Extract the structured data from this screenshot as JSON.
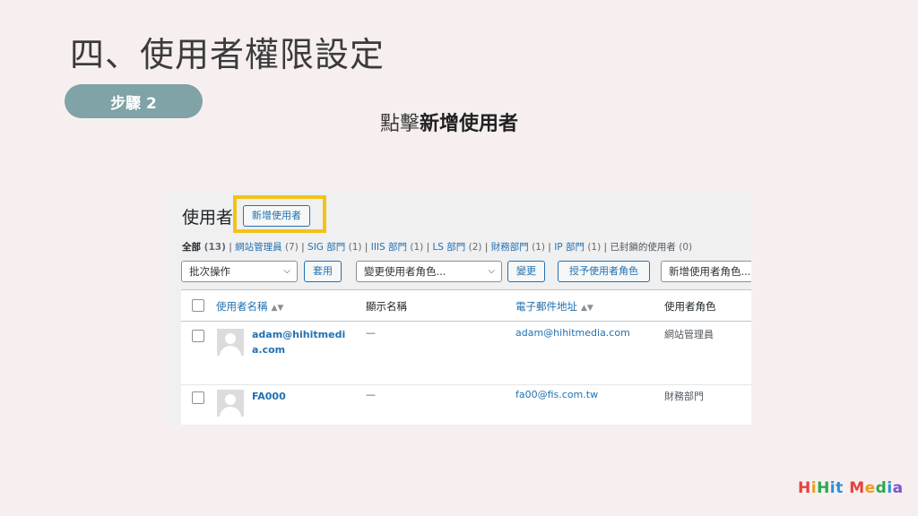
{
  "slide": {
    "title": "四、使用者權限設定",
    "step_label": "步驟 2",
    "caption_prefix": "點擊",
    "caption_bold": "新增使用者"
  },
  "wp": {
    "heading": "使用者",
    "add_button": "新增使用者",
    "filters": [
      {
        "label": "全部",
        "count": "(13)",
        "current": true
      },
      {
        "label": "網站管理員",
        "count": "(7)"
      },
      {
        "label": "SIG 部門",
        "count": "(1)"
      },
      {
        "label": "IIIS 部門",
        "count": "(1)"
      },
      {
        "label": "LS 部門",
        "count": "(2)"
      },
      {
        "label": "財務部門",
        "count": "(1)"
      },
      {
        "label": "IP 部門",
        "count": "(1)"
      },
      {
        "label": "已封鎖的使用者",
        "count": "(0)",
        "plain": true
      }
    ],
    "bulk_select": "批次操作",
    "apply_button": "套用",
    "role_change_select": "變更使用者角色...",
    "change_button": "變更",
    "grant_role_button": "授予使用者角色",
    "new_role_select": "新增使用者角色...",
    "columns": {
      "username": "使用者名稱",
      "display_name": "顯示名稱",
      "email": "電子郵件地址",
      "role": "使用者角色"
    },
    "rows": [
      {
        "username": "adam@hihitmedia.com",
        "display_name": "—",
        "email": "adam@hihitmedia.com",
        "role": "網站管理員"
      },
      {
        "username": "FA000",
        "display_name": "—",
        "email": "fa00@fis.com.tw",
        "role": "財務部門"
      }
    ]
  },
  "logo_text": "HiHit Media",
  "colors": {
    "background": "#f7efef",
    "step_pill": "#7fa3a7",
    "highlight": "#f2c318",
    "wp_link": "#2271b1"
  }
}
